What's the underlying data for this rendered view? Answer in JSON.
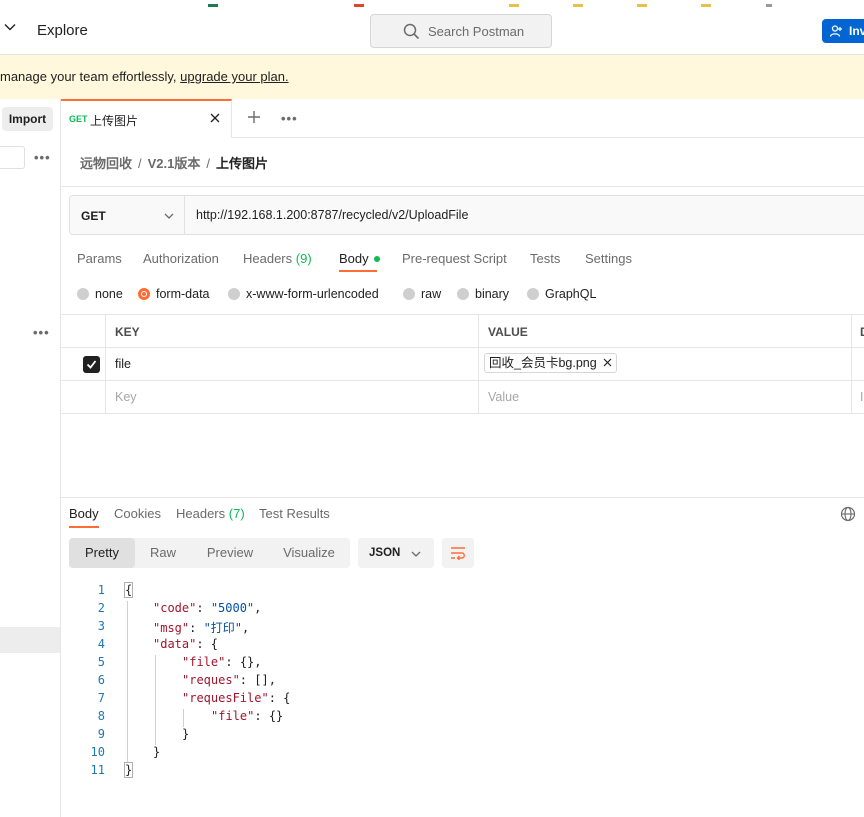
{
  "topbar": {
    "explore_label": "Explore",
    "search_placeholder": "Search Postman",
    "invite_label": "Invi"
  },
  "banner": {
    "text": "manage your team effortlessly, ",
    "link": "upgrade your plan."
  },
  "sidebar": {
    "import_label": "Import"
  },
  "tab": {
    "method": "GET",
    "title": "上传图片"
  },
  "breadcrumb": {
    "items": [
      "远物回收",
      "V2.1版本"
    ],
    "current": "上传图片",
    "separator": "/"
  },
  "request": {
    "method": "GET",
    "url": "http://192.168.1.200:8787/recycled/v2/UploadFile"
  },
  "request_tabs": {
    "params": "Params",
    "authorization": "Authorization",
    "headers": "Headers",
    "headers_count": "(9)",
    "body": "Body",
    "prerequest": "Pre-request Script",
    "tests": "Tests",
    "settings": "Settings"
  },
  "body_types": {
    "none": "none",
    "form_data": "form-data",
    "urlencoded": "x-www-form-urlencoded",
    "raw": "raw",
    "binary": "binary",
    "graphql": "GraphQL"
  },
  "form_table": {
    "col_key": "KEY",
    "col_value": "VALUE",
    "col_desc": "D",
    "row_key": "file",
    "row_value": "回收_会员卡bg.png",
    "key_placeholder": "Key",
    "value_placeholder": "Value",
    "desc_placeholder": "I"
  },
  "response_tabs": {
    "body": "Body",
    "cookies": "Cookies",
    "headers": "Headers",
    "headers_count": "(7)",
    "test_results": "Test Results"
  },
  "view_modes": {
    "pretty": "Pretty",
    "raw": "Raw",
    "preview": "Preview",
    "visualize": "Visualize"
  },
  "format": "JSON",
  "code_lines": {
    "l1": "{",
    "l2_key": "\"code\"",
    "l2_val": "\"5000\"",
    "l3_key": "\"msg\"",
    "l3_val": "\"打印\"",
    "l4_key": "\"data\"",
    "l5_key": "\"file\"",
    "l5_val": "{}",
    "l6_key": "\"reques\"",
    "l6_val": "[]",
    "l7_key": "\"requesFile\"",
    "l8_key": "\"file\"",
    "l8_val": "{}",
    "l9": "}",
    "l10": "}",
    "l11": "}"
  },
  "line_numbers": [
    "1",
    "2",
    "3",
    "4",
    "5",
    "6",
    "7",
    "8",
    "9",
    "10",
    "11"
  ],
  "colors": {
    "accent": "#ff6c37",
    "green": "#0cbb52",
    "invite_blue": "#0265d2",
    "banner_bg": "#fff8dd"
  }
}
